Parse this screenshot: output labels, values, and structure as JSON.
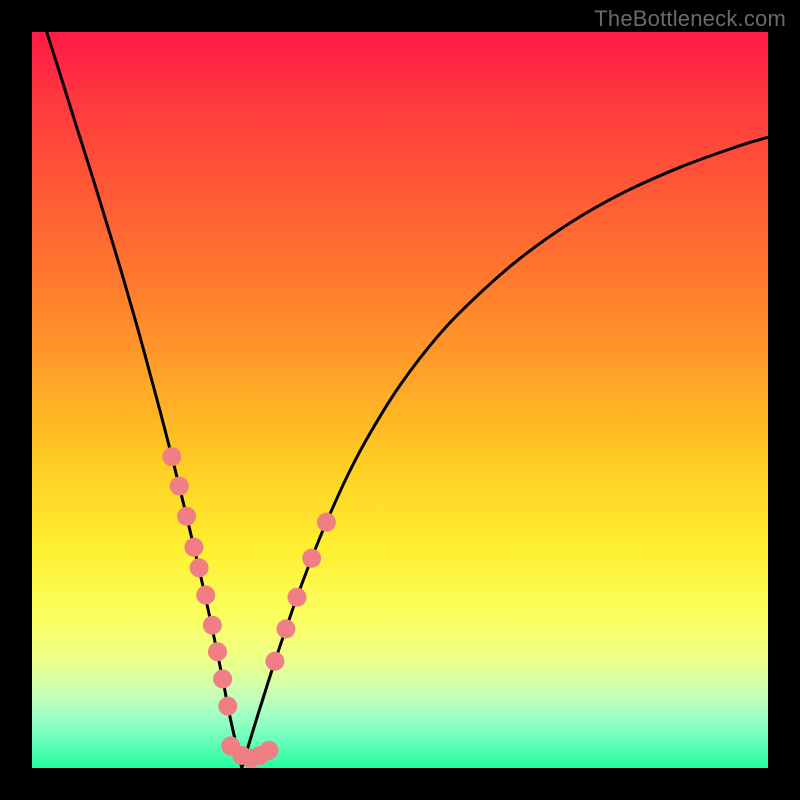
{
  "watermark": {
    "text": "TheBottleneck.com"
  },
  "colors": {
    "curve": "#000000",
    "dot_fill": "#ef7f84",
    "dot_stroke": "#d55f63"
  },
  "chart_data": {
    "type": "line",
    "title": "",
    "xlabel": "",
    "ylabel": "",
    "xlim": [
      0,
      100
    ],
    "ylim": [
      0,
      100
    ],
    "grid": false,
    "series": [
      {
        "name": "left-curve",
        "x": [
          2.0,
          4.0,
          6.0,
          8.0,
          10.0,
          12.0,
          14.0,
          15.0,
          16.0,
          17.0,
          18.0,
          19.0,
          20.0,
          21.0,
          22.0,
          23.0,
          24.0,
          25.0,
          26.0,
          27.0,
          28.5
        ],
        "y": [
          100.0,
          93.7,
          87.3,
          81.0,
          74.5,
          67.9,
          61.0,
          57.4,
          53.7,
          50.0,
          46.2,
          42.3,
          38.3,
          34.2,
          30.0,
          25.7,
          21.2,
          16.5,
          11.6,
          6.5,
          0.0
        ]
      },
      {
        "name": "right-curve",
        "x": [
          28.5,
          30.0,
          31.5,
          33.0,
          34.5,
          36.0,
          38.0,
          40.0,
          43.0,
          46.0,
          50.0,
          55.0,
          60.0,
          66.0,
          73.0,
          80.0,
          88.0,
          96.0,
          100.0
        ],
        "y": [
          0.0,
          5.0,
          9.8,
          14.5,
          18.9,
          23.2,
          28.5,
          33.4,
          40.0,
          45.6,
          52.0,
          58.5,
          63.7,
          69.0,
          74.0,
          78.0,
          81.6,
          84.5,
          85.7
        ]
      }
    ],
    "dot_clusters": [
      {
        "name": "left-cluster",
        "points": [
          [
            19.0,
            42.3
          ],
          [
            20.0,
            38.3
          ],
          [
            21.0,
            34.2
          ],
          [
            22.0,
            30.0
          ],
          [
            22.7,
            27.2
          ],
          [
            23.6,
            23.5
          ],
          [
            24.5,
            19.4
          ],
          [
            25.2,
            15.8
          ],
          [
            25.9,
            12.1
          ],
          [
            26.6,
            8.4
          ]
        ]
      },
      {
        "name": "bottom-cluster",
        "points": [
          [
            27.0,
            3.0
          ],
          [
            28.5,
            1.7
          ],
          [
            29.8,
            1.3
          ],
          [
            31.0,
            1.7
          ],
          [
            32.2,
            2.4
          ]
        ]
      },
      {
        "name": "right-cluster",
        "points": [
          [
            33.0,
            14.5
          ],
          [
            34.5,
            18.9
          ],
          [
            36.0,
            23.2
          ],
          [
            38.0,
            28.5
          ],
          [
            40.0,
            33.4
          ]
        ]
      }
    ]
  }
}
